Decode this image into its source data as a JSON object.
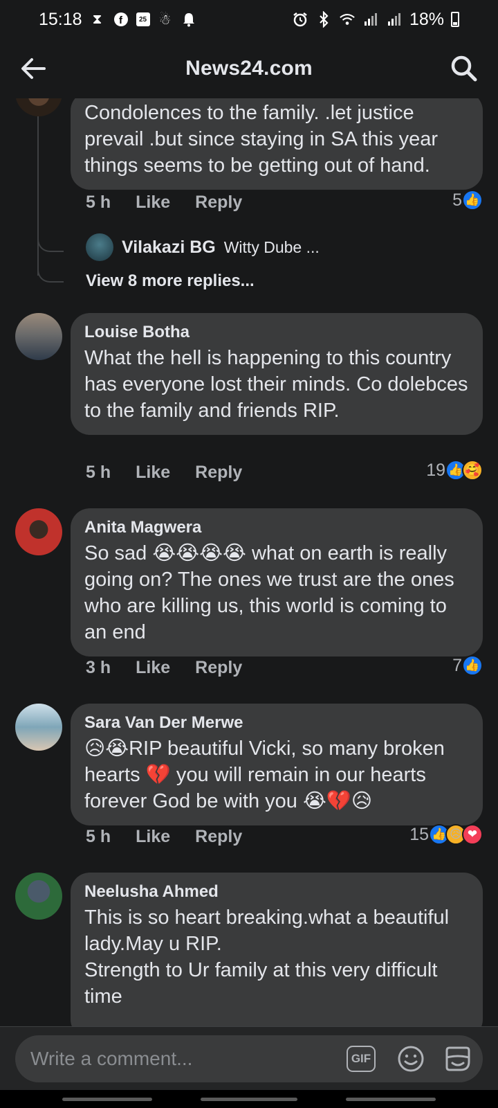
{
  "status_bar": {
    "time": "15:18",
    "battery_text": "18%",
    "icons": [
      "hourglass-icon",
      "facebook-icon",
      "calendar-icon",
      "weather-icon",
      "bell-icon",
      "alarm-icon",
      "bluetooth-icon",
      "wifi-icon",
      "signal-icon",
      "signal-icon",
      "battery-icon"
    ],
    "calendar_day": "25"
  },
  "app_bar": {
    "title": "News24.com",
    "back_icon": "back-arrow-icon",
    "search_icon": "search-icon"
  },
  "top_reply": {
    "text": "Condolences to the family. .let justice prevail .but since staying in SA this year things seems to be getting out of hand.",
    "time": "5 h",
    "like_label": "Like",
    "reply_label": "Reply",
    "reaction_count": "5",
    "reactions": [
      "like"
    ]
  },
  "nested_reply": {
    "author": "Vilakazi BG",
    "preview": "Witty Dube ..."
  },
  "view_more_replies": "View 8 more replies...",
  "comments": [
    {
      "author": "Louise Botha",
      "text": "What the hell is happening to this country has everyone lost their minds. Co dolebces to the family and friends RIP.",
      "time": "5 h",
      "like_label": "Like",
      "reply_label": "Reply",
      "reaction_count": "19",
      "reactions": [
        "like",
        "care"
      ]
    },
    {
      "author": "Anita Magwera",
      "text": "So sad 😭😭😭😭 what on earth is really going on? The ones we trust are the ones who are killing us, this world is coming to an end",
      "time": "3 h",
      "like_label": "Like",
      "reply_label": "Reply",
      "reaction_count": "7",
      "reactions": [
        "like"
      ]
    },
    {
      "author": "Sara Van Der Merwe",
      "text": "😥😭RIP beautiful Vicki, so many broken hearts 💔 you will remain in our hearts forever God be with you 😭💔😥",
      "time": "5 h",
      "like_label": "Like",
      "reply_label": "Reply",
      "reaction_count": "15",
      "reactions": [
        "like",
        "sad",
        "love"
      ]
    },
    {
      "author": "Neelusha Ahmed",
      "text": "This is so heart breaking.what a beautiful lady.May u RIP.\nStrength to Ur family at this very difficult time"
    }
  ],
  "composer": {
    "placeholder": "Write a comment...",
    "gif_label": "GIF",
    "emoji_icon": "smiley-icon",
    "sticker_icon": "sticker-icon"
  },
  "colors": {
    "background": "#18191a",
    "bubble": "#3a3b3c",
    "text_primary": "#e4e6eb",
    "text_secondary": "#b0b3b8",
    "like_blue": "#1877f2",
    "love_red": "#f33e58",
    "reaction_yellow": "#f7b125"
  }
}
